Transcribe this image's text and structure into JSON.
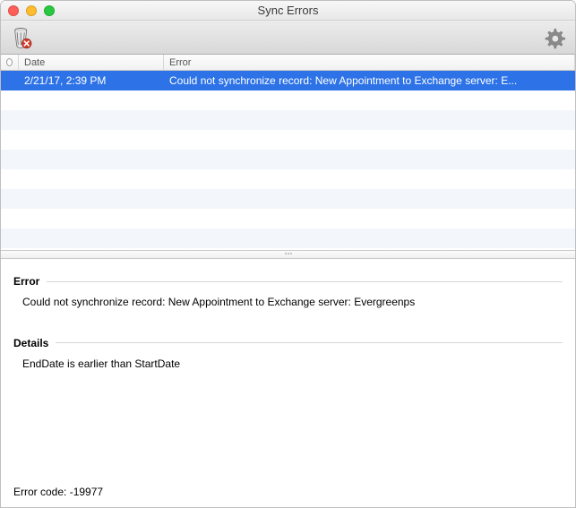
{
  "window": {
    "title": "Sync Errors"
  },
  "toolbar": {
    "trash_tooltip": "Delete selected",
    "settings_tooltip": "Settings"
  },
  "columns": {
    "date": "Date",
    "error": "Error"
  },
  "rows": [
    {
      "date": "2/21/17, 2:39 PM",
      "error": "Could not synchronize record: New Appointment to Exchange server: E...",
      "selected": true
    }
  ],
  "detail": {
    "error_label": "Error",
    "error_text": "Could not synchronize record: New Appointment to Exchange server: Evergreenps",
    "details_label": "Details",
    "details_text": "EndDate is earlier than StartDate",
    "error_code_label": "Error code:",
    "error_code_value": "-19977"
  }
}
